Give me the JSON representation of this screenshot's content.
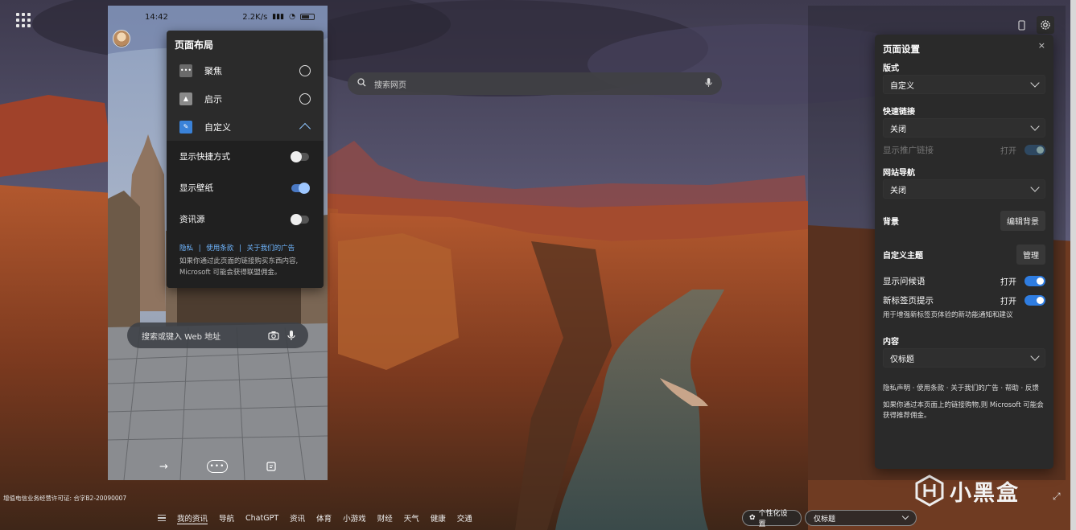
{
  "phone": {
    "status_time": "14:42",
    "status_info": "2.2K/s",
    "search_placeholder": "搜索或键入 Web 地址",
    "nav_more": "•••"
  },
  "layout_menu": {
    "title": "页面布局",
    "options": [
      {
        "label": "聚焦"
      },
      {
        "label": "启示"
      },
      {
        "label": "自定义"
      }
    ],
    "toggles": [
      {
        "label": "显示快捷方式",
        "on": false
      },
      {
        "label": "显示壁纸",
        "on": true
      },
      {
        "label": "资讯源",
        "on": false
      }
    ],
    "links": [
      "隐私",
      "使用条款",
      "关于我们的广告"
    ],
    "link_sep": "|",
    "disclaimer_line1": "如果你通过此页面的链接购买东西内容,",
    "disclaimer_line2": "Microsoft 可能会获得联盟佣金。"
  },
  "web_search": {
    "placeholder": "搜索网页"
  },
  "settings": {
    "title": "页面设置",
    "close": "×",
    "layout_label": "版式",
    "layout_value": "自定义",
    "quicklinks_label": "快速链接",
    "quicklinks_value": "关闭",
    "promo_label": "显示推广链接",
    "promo_state": "打开",
    "sitenav_label": "网站导航",
    "sitenav_value": "关闭",
    "background_label": "背景",
    "background_button": "编辑背景",
    "theme_label": "自定义主题",
    "theme_button": "管理",
    "greeting_label": "显示问候语",
    "greeting_state": "打开",
    "tips_label": "新标签页提示",
    "tips_state": "打开",
    "tips_desc": "用于增强新标签页体验的新功能通知和建议",
    "content_label": "内容",
    "content_value": "仅标题",
    "footer_links": "隐私声明 · 使用条款 · 关于我们的广告 · 帮助 · 反馈",
    "footer_note_1": "如果你通过本页面上的链接购物,则 Microsoft 可能会",
    "footer_note_2": "获得推荐佣金。"
  },
  "bottom": {
    "icp": "增值电信业务经营许可证: 合字B2-20090007",
    "nav": [
      "我的资讯",
      "导航",
      "ChatGPT",
      "资讯",
      "体育",
      "小游戏",
      "财经",
      "天气",
      "健康",
      "交通"
    ],
    "personalize": "个性化设置",
    "title_select": "仅标题",
    "watermark": "小黑盒"
  }
}
